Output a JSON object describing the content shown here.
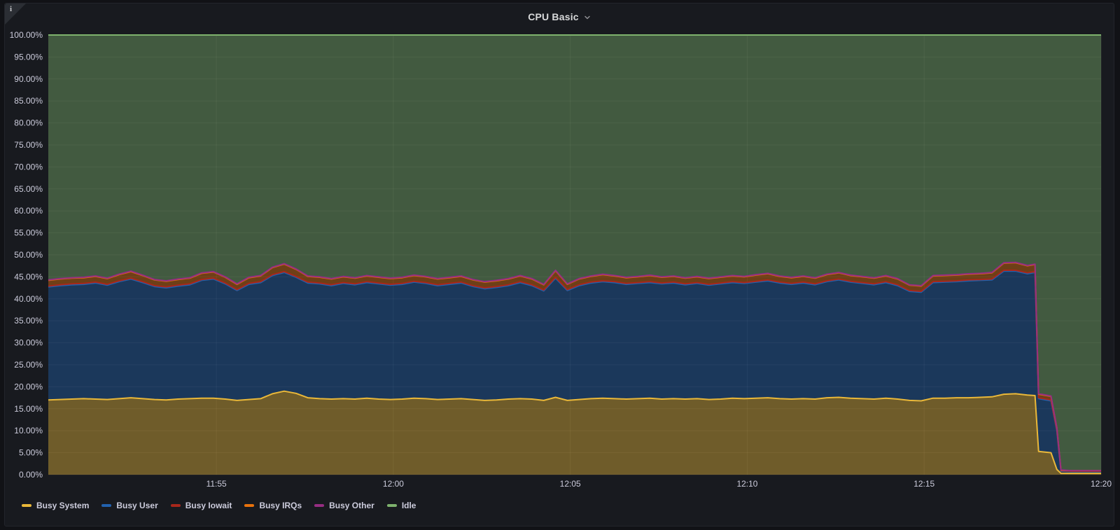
{
  "panel": {
    "title": "CPU Basic",
    "info_icon": "i"
  },
  "colors": {
    "page_bg": "#111216",
    "panel_bg": "#181A1F",
    "panel_border": "#23252B",
    "grid": "rgba(255,255,255,0.07)",
    "tick_text": "#CCCCDC",
    "title_text": "#D8D9DA"
  },
  "chart_data": {
    "type": "area",
    "stacked": true,
    "title": "CPU Basic",
    "unit": "percent",
    "ylim": [
      0,
      100
    ],
    "grid": true,
    "legend_position": "bottom",
    "fill_opacity": 0.42,
    "line_width": 2,
    "x_range": [
      "11:50:15",
      "12:20:00"
    ],
    "x_ticks": [
      "11:55",
      "12:00",
      "12:05",
      "12:10",
      "12:15",
      "12:20"
    ],
    "y_ticks": [
      "0.00%",
      "5.00%",
      "10.00%",
      "15.00%",
      "20.00%",
      "25.00%",
      "30.00%",
      "35.00%",
      "40.00%",
      "45.00%",
      "50.00%",
      "55.00%",
      "60.00%",
      "65.00%",
      "70.00%",
      "75.00%",
      "80.00%",
      "85.00%",
      "90.00%",
      "95.00%",
      "100.00%"
    ],
    "times": [
      "11:50:15",
      "11:50:35",
      "11:50:55",
      "11:51:15",
      "11:51:35",
      "11:51:55",
      "11:52:15",
      "11:52:35",
      "11:52:55",
      "11:53:15",
      "11:53:35",
      "11:53:55",
      "11:54:15",
      "11:54:35",
      "11:54:55",
      "11:55:15",
      "11:55:35",
      "11:55:55",
      "11:56:15",
      "11:56:35",
      "11:56:55",
      "11:57:15",
      "11:57:35",
      "11:57:55",
      "11:58:15",
      "11:58:35",
      "11:58:55",
      "11:59:15",
      "11:59:35",
      "11:59:55",
      "12:00:15",
      "12:00:35",
      "12:00:55",
      "12:01:15",
      "12:01:35",
      "12:01:55",
      "12:02:15",
      "12:02:35",
      "12:02:55",
      "12:03:15",
      "12:03:35",
      "12:03:55",
      "12:04:15",
      "12:04:35",
      "12:04:55",
      "12:05:15",
      "12:05:35",
      "12:05:55",
      "12:06:15",
      "12:06:35",
      "12:06:55",
      "12:07:15",
      "12:07:35",
      "12:07:55",
      "12:08:15",
      "12:08:35",
      "12:08:55",
      "12:09:15",
      "12:09:35",
      "12:09:55",
      "12:10:15",
      "12:10:35",
      "12:10:55",
      "12:11:15",
      "12:11:35",
      "12:11:55",
      "12:12:15",
      "12:12:35",
      "12:12:55",
      "12:13:15",
      "12:13:35",
      "12:13:55",
      "12:14:15",
      "12:14:35",
      "12:14:55",
      "12:15:15",
      "12:15:35",
      "12:15:55",
      "12:16:15",
      "12:16:35",
      "12:16:55",
      "12:17:15",
      "12:17:35",
      "12:17:55",
      "12:18:08",
      "12:18:14",
      "12:18:35",
      "12:18:45",
      "12:18:52",
      "12:19:10",
      "12:19:30",
      "12:19:50",
      "12:20:00"
    ],
    "series": [
      {
        "name": "Busy System",
        "color": "#EAB839",
        "values": [
          17.0,
          17.1,
          17.2,
          17.3,
          17.2,
          17.1,
          17.3,
          17.5,
          17.3,
          17.1,
          17.0,
          17.2,
          17.3,
          17.4,
          17.4,
          17.2,
          16.9,
          17.1,
          17.3,
          18.4,
          19.0,
          18.5,
          17.5,
          17.3,
          17.2,
          17.3,
          17.2,
          17.4,
          17.2,
          17.1,
          17.2,
          17.4,
          17.3,
          17.1,
          17.2,
          17.3,
          17.1,
          16.9,
          17.0,
          17.2,
          17.3,
          17.2,
          16.9,
          17.6,
          16.9,
          17.1,
          17.3,
          17.4,
          17.3,
          17.2,
          17.3,
          17.4,
          17.2,
          17.3,
          17.2,
          17.3,
          17.1,
          17.2,
          17.4,
          17.3,
          17.4,
          17.5,
          17.3,
          17.2,
          17.3,
          17.2,
          17.5,
          17.6,
          17.4,
          17.3,
          17.2,
          17.4,
          17.2,
          16.9,
          16.8,
          17.4,
          17.4,
          17.5,
          17.5,
          17.6,
          17.7,
          18.3,
          18.4,
          18.1,
          18.0,
          5.3,
          5.0,
          1.2,
          0.3,
          0.3,
          0.3,
          0.3,
          0.3
        ]
      },
      {
        "name": "Busy User",
        "color": "#2262AE",
        "values": [
          25.7,
          25.9,
          26.0,
          26.0,
          26.4,
          26.0,
          26.6,
          27.0,
          26.4,
          25.7,
          25.5,
          25.7,
          25.9,
          26.8,
          27.1,
          26.2,
          25.0,
          26.2,
          26.4,
          26.9,
          27.0,
          26.4,
          26.1,
          26.1,
          25.8,
          26.2,
          26.0,
          26.3,
          26.2,
          26.0,
          26.1,
          26.4,
          26.2,
          25.9,
          26.1,
          26.3,
          25.7,
          25.4,
          25.6,
          25.8,
          26.4,
          25.8,
          24.9,
          27.1,
          25.0,
          25.9,
          26.3,
          26.5,
          26.4,
          26.1,
          26.2,
          26.3,
          26.2,
          26.3,
          26.0,
          26.2,
          26.0,
          26.2,
          26.3,
          26.2,
          26.4,
          26.6,
          26.3,
          26.1,
          26.3,
          26.0,
          26.4,
          26.7,
          26.4,
          26.2,
          26.0,
          26.3,
          25.8,
          24.8,
          24.7,
          26.3,
          26.4,
          26.4,
          26.6,
          26.6,
          26.6,
          28.0,
          27.9,
          27.6,
          28.0,
          12.0,
          11.8,
          8.8,
          0.5,
          0.4,
          0.4,
          0.4,
          0.4
        ]
      },
      {
        "name": "Busy Iowait",
        "color": "#A8271B",
        "values": [
          0.2,
          0.2,
          0.2,
          0.2,
          0.2,
          0.2,
          0.2,
          0.2,
          0.2,
          0.2,
          0.2,
          0.2,
          0.2,
          0.2,
          0.2,
          0.2,
          0.2,
          0.2,
          0.2,
          0.2,
          0.2,
          0.2,
          0.2,
          0.2,
          0.2,
          0.2,
          0.2,
          0.2,
          0.2,
          0.2,
          0.2,
          0.2,
          0.2,
          0.2,
          0.2,
          0.2,
          0.2,
          0.2,
          0.2,
          0.2,
          0.2,
          0.2,
          0.2,
          0.2,
          0.2,
          0.2,
          0.2,
          0.2,
          0.2,
          0.2,
          0.2,
          0.2,
          0.2,
          0.2,
          0.2,
          0.2,
          0.2,
          0.2,
          0.2,
          0.2,
          0.2,
          0.2,
          0.2,
          0.2,
          0.2,
          0.2,
          0.2,
          0.2,
          0.2,
          0.2,
          0.2,
          0.2,
          0.2,
          0.2,
          0.2,
          0.2,
          0.2,
          0.2,
          0.2,
          0.2,
          0.2,
          0.2,
          0.2,
          0.2,
          0.2,
          0.2,
          0.2,
          0.2,
          0.1,
          0.1,
          0.1,
          0.1,
          0.1
        ]
      },
      {
        "name": "Busy IRQs",
        "color": "#E8720C",
        "values": [
          1.3,
          1.3,
          1.3,
          1.3,
          1.3,
          1.3,
          1.4,
          1.5,
          1.4,
          1.3,
          1.3,
          1.3,
          1.3,
          1.4,
          1.4,
          1.3,
          1.2,
          1.3,
          1.3,
          1.6,
          1.7,
          1.6,
          1.3,
          1.3,
          1.3,
          1.3,
          1.3,
          1.3,
          1.3,
          1.3,
          1.3,
          1.3,
          1.3,
          1.3,
          1.3,
          1.3,
          1.3,
          1.3,
          1.3,
          1.3,
          1.3,
          1.3,
          1.2,
          1.5,
          1.2,
          1.3,
          1.3,
          1.4,
          1.3,
          1.3,
          1.3,
          1.4,
          1.3,
          1.3,
          1.3,
          1.3,
          1.3,
          1.3,
          1.3,
          1.3,
          1.4,
          1.4,
          1.3,
          1.3,
          1.3,
          1.3,
          1.4,
          1.4,
          1.3,
          1.3,
          1.3,
          1.3,
          1.3,
          1.2,
          1.2,
          1.3,
          1.3,
          1.3,
          1.3,
          1.3,
          1.4,
          1.6,
          1.7,
          1.6,
          1.6,
          0.8,
          0.8,
          0.4,
          0.1,
          0.1,
          0.1,
          0.1,
          0.1
        ]
      },
      {
        "name": "Busy Other",
        "color": "#962D82",
        "values": [
          0.1,
          0.1,
          0.1,
          0.1,
          0.1,
          0.1,
          0.1,
          0.1,
          0.1,
          0.1,
          0.1,
          0.1,
          0.1,
          0.1,
          0.1,
          0.1,
          0.1,
          0.1,
          0.1,
          0.1,
          0.1,
          0.1,
          0.1,
          0.1,
          0.1,
          0.1,
          0.1,
          0.1,
          0.1,
          0.1,
          0.1,
          0.1,
          0.1,
          0.1,
          0.1,
          0.1,
          0.1,
          0.1,
          0.1,
          0.1,
          0.1,
          0.1,
          0.1,
          0.1,
          0.1,
          0.1,
          0.1,
          0.1,
          0.1,
          0.1,
          0.1,
          0.1,
          0.1,
          0.1,
          0.1,
          0.1,
          0.1,
          0.1,
          0.1,
          0.1,
          0.1,
          0.1,
          0.1,
          0.1,
          0.1,
          0.1,
          0.1,
          0.1,
          0.1,
          0.1,
          0.1,
          0.1,
          0.1,
          0.1,
          0.1,
          0.1,
          0.1,
          0.1,
          0.1,
          0.1,
          0.1,
          0.1,
          0.1,
          0.1,
          0.1,
          0.1,
          0.1,
          0.1,
          0.1,
          0.0,
          0.0,
          0.0,
          0.0
        ]
      },
      {
        "name": "Idle",
        "color": "#7EB26D",
        "values": [
          55.7,
          55.4,
          55.2,
          55.1,
          54.8,
          55.3,
          54.4,
          53.7,
          54.6,
          55.6,
          55.9,
          55.5,
          55.2,
          54.1,
          53.8,
          55.0,
          56.6,
          55.1,
          54.7,
          52.8,
          52.0,
          53.2,
          54.8,
          55.0,
          55.4,
          54.9,
          55.2,
          54.7,
          55.0,
          55.3,
          55.1,
          54.6,
          54.9,
          55.4,
          55.1,
          54.8,
          55.6,
          56.1,
          55.8,
          55.4,
          54.7,
          55.4,
          56.7,
          53.5,
          56.6,
          55.4,
          54.8,
          54.4,
          54.7,
          55.1,
          54.9,
          54.6,
          55.0,
          54.8,
          55.2,
          54.9,
          55.3,
          55.0,
          54.7,
          54.9,
          54.5,
          54.2,
          54.8,
          55.1,
          54.8,
          55.2,
          54.4,
          54.0,
          54.6,
          54.9,
          55.2,
          54.7,
          55.4,
          56.8,
          57.0,
          54.7,
          54.6,
          54.5,
          54.3,
          54.2,
          54.0,
          51.8,
          51.7,
          52.4,
          52.1,
          81.6,
          82.1,
          89.3,
          98.9,
          99.1,
          99.1,
          99.1,
          99.1
        ]
      }
    ]
  }
}
